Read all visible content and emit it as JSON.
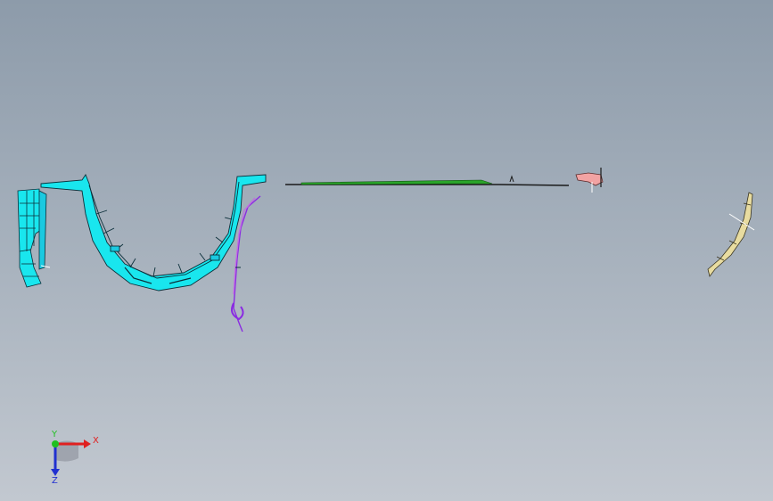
{
  "viewport": {
    "background_top": "#8d9baa",
    "background_bottom": "#c2c8d0"
  },
  "parts": [
    {
      "name": "left-bracket-part",
      "color": "#19e6ee"
    },
    {
      "name": "wheel-arch-liner-part",
      "color": "#19e6ee"
    },
    {
      "name": "vertical-seal-part",
      "color": "#8a2be2"
    },
    {
      "name": "long-strip-part",
      "color": "#2aa52a"
    },
    {
      "name": "small-clip-part",
      "color": "#f2a3a3"
    },
    {
      "name": "curved-trim-part",
      "color": "#e8dca0"
    }
  ],
  "triad": {
    "x_label": "X",
    "y_label": "Y",
    "z_label": "Z",
    "x_color": "#e02020",
    "y_color": "#20c020",
    "z_color": "#2030d0"
  }
}
